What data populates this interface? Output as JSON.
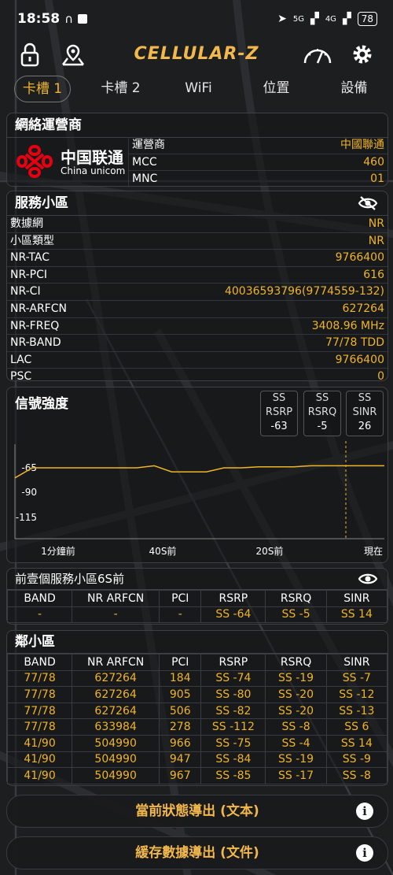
{
  "status_bar": {
    "time": "18:58",
    "net1": "5G",
    "net2": "4G",
    "battery": "78"
  },
  "app": {
    "title": "CELLULAR-Z"
  },
  "tabs": [
    "卡槽 1",
    "卡槽 2",
    "WiFi",
    "位置",
    "設備"
  ],
  "operator_card": {
    "title": "網絡運營商",
    "logo_cn": "中国联通",
    "logo_en": "China unicom",
    "rows": [
      {
        "label": "運營商",
        "value": "中國聯通"
      },
      {
        "label": "MCC",
        "value": "460"
      },
      {
        "label": "MNC",
        "value": "01"
      }
    ]
  },
  "serving_card": {
    "title": "服務小區",
    "rows": [
      {
        "label": "數據網",
        "value": "NR"
      },
      {
        "label": "小區類型",
        "value": "NR"
      },
      {
        "label": "NR-TAC",
        "value": "9766400"
      },
      {
        "label": "NR-PCI",
        "value": "616"
      },
      {
        "label": "NR-CI",
        "value": "40036593796(9774559-132)"
      },
      {
        "label": "NR-ARFCN",
        "value": "627264"
      },
      {
        "label": "NR-FREQ",
        "value": "3408.96 MHz"
      },
      {
        "label": "NR-BAND",
        "value": "77/78 TDD"
      },
      {
        "label": "LAC",
        "value": "9766400"
      },
      {
        "label": "PSC",
        "value": "0"
      }
    ]
  },
  "signal_card": {
    "title": "信號強度",
    "boxes": [
      {
        "l1": "SS",
        "l2": "RSRP",
        "val": "-63"
      },
      {
        "l1": "SS",
        "l2": "RSRQ",
        "val": "-5"
      },
      {
        "l1": "SS",
        "l2": "SINR",
        "val": "26"
      }
    ],
    "chart_data": {
      "type": "line",
      "y_ticks": [
        "-65",
        "-90",
        "-115"
      ],
      "x_labels": [
        "1分鐘前",
        "40S前",
        "20S前",
        "現在"
      ],
      "series": [
        {
          "values": [
            -75,
            -65,
            -65,
            -65,
            -65,
            -65,
            -65,
            -65,
            -63,
            -69,
            -69,
            -69,
            -65,
            -65,
            -64,
            -64,
            -64,
            -63,
            -63,
            -63
          ]
        }
      ]
    }
  },
  "prev_card": {
    "title": "前壹個服務小區6S前",
    "headers": [
      "BAND",
      "NR ARFCN",
      "PCI",
      "RSRP",
      "RSRQ",
      "SINR"
    ],
    "row": [
      "-",
      "-",
      "-",
      "SS -64",
      "SS -5",
      "SS 14"
    ]
  },
  "neighbor_card": {
    "title": "鄰小區",
    "headers": [
      "BAND",
      "NR ARFCN",
      "PCI",
      "RSRP",
      "RSRQ",
      "SINR"
    ],
    "rows": [
      [
        "77/78",
        "627264",
        "184",
        "SS -74",
        "SS -19",
        "SS -7"
      ],
      [
        "77/78",
        "627264",
        "905",
        "SS -80",
        "SS -20",
        "SS -12"
      ],
      [
        "77/78",
        "627264",
        "506",
        "SS -82",
        "SS -20",
        "SS -13"
      ],
      [
        "77/78",
        "633984",
        "278",
        "SS -112",
        "SS -8",
        "SS 6"
      ],
      [
        "41/90",
        "504990",
        "966",
        "SS -75",
        "SS -4",
        "SS 14"
      ],
      [
        "41/90",
        "504990",
        "947",
        "SS -84",
        "SS -19",
        "SS -9"
      ],
      [
        "41/90",
        "504990",
        "967",
        "SS -85",
        "SS -17",
        "SS -8"
      ]
    ]
  },
  "buttons": {
    "export_text": "當前狀態導出 (文本)",
    "export_file": "緩存數據導出 (文件)"
  },
  "colors": {
    "accent": "#f0b429",
    "background": "#1b1c1e"
  }
}
